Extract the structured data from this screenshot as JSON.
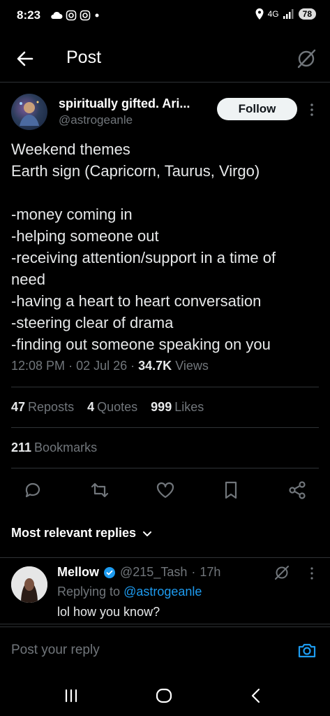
{
  "status_bar": {
    "time": "8:23",
    "network": "4G",
    "battery": "78"
  },
  "header": {
    "title": "Post"
  },
  "author": {
    "name": "spiritually gifted. Ari...",
    "handle": "@astrogeanle",
    "follow_label": "Follow"
  },
  "post": {
    "lines": [
      "Weekend themes",
      "Earth sign (Capricorn, Taurus, Virgo)",
      "",
      "-money coming in",
      "-helping someone out",
      "-receiving attention/support in a time of",
      "need",
      "-having a heart to heart conversation",
      "-steering clear of drama",
      "-finding out someone speaking on you"
    ],
    "time": "12:08 PM",
    "date": "02 Jul 26",
    "views_count": "34.7K",
    "views_label": "Views"
  },
  "stats": {
    "reposts_count": "47",
    "reposts_label": "Reposts",
    "quotes_count": "4",
    "quotes_label": "Quotes",
    "likes_count": "999",
    "likes_label": "Likes",
    "bookmarks_count": "211",
    "bookmarks_label": "Bookmarks"
  },
  "replies_header": {
    "label": "Most relevant replies"
  },
  "reply": {
    "name": "Mellow",
    "handle": "@215_Tash",
    "time": "17h",
    "replying_prefix": "Replying to",
    "replying_to": "@astrogeanle",
    "text": "lol how you know?"
  },
  "compose": {
    "placeholder": "Post your reply"
  },
  "colors": {
    "background": "#000000",
    "accent": "#1d9bf0",
    "muted": "#71767b",
    "divider": "#2f3336"
  },
  "icons": [
    "back-arrow-icon",
    "grok-icon",
    "more-icon",
    "reply-icon",
    "repost-icon",
    "like-icon",
    "bookmark-icon",
    "share-icon",
    "chevron-down-icon",
    "verified-icon",
    "camera-icon",
    "recents-icon",
    "home-icon",
    "back-icon"
  ]
}
